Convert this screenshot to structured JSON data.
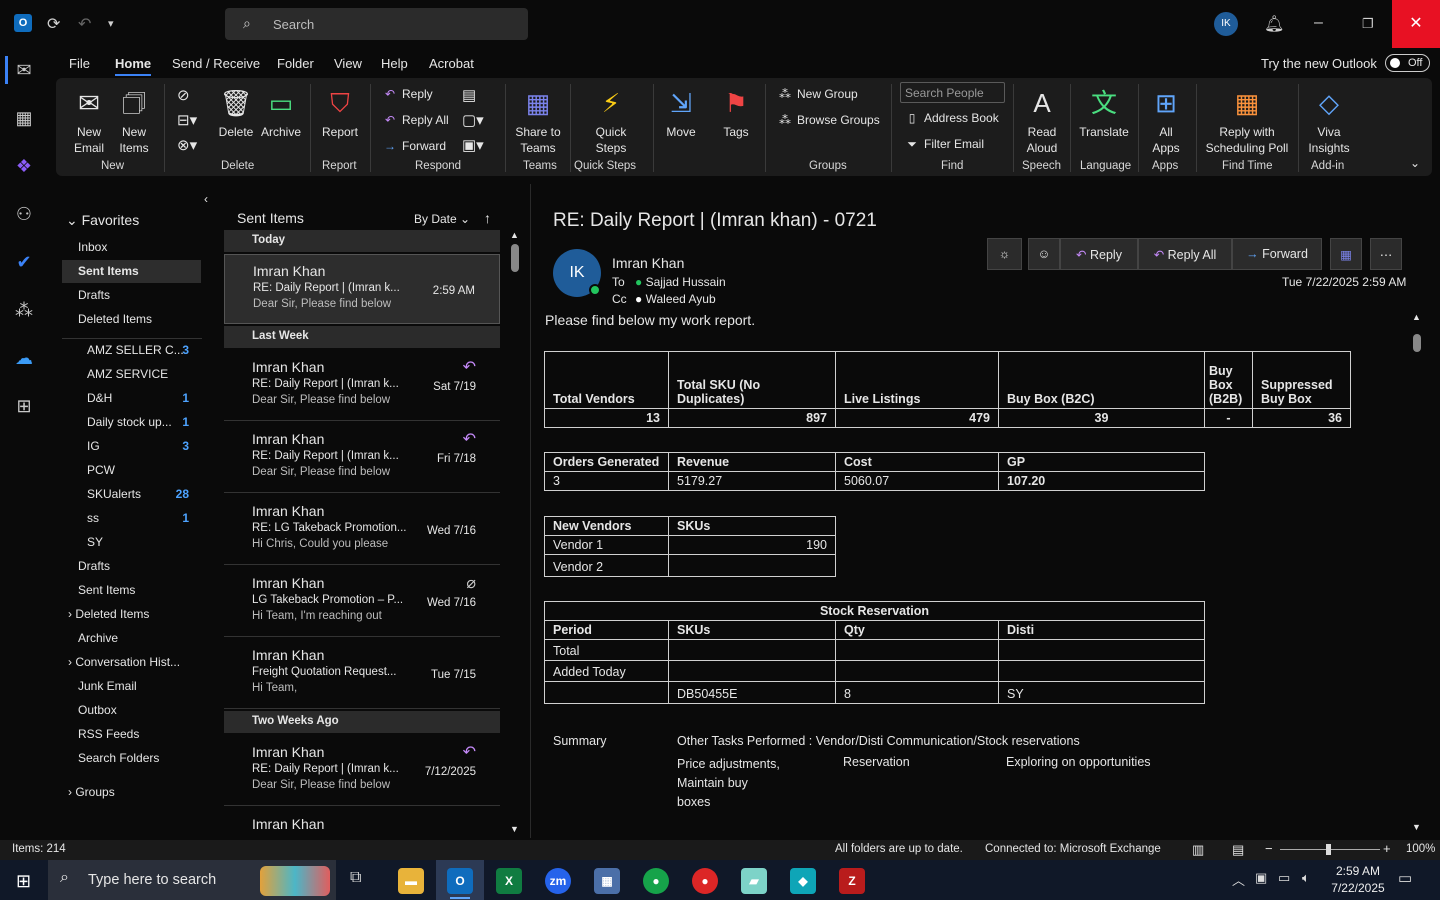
{
  "titlebar": {
    "search_placeholder": "Search",
    "avatar": "IK"
  },
  "menu": {
    "items": [
      "File",
      "Home",
      "Send / Receive",
      "Folder",
      "View",
      "Help",
      "Acrobat"
    ],
    "try_new": "Try the new Outlook",
    "toggle": "Off"
  },
  "ribbon": {
    "new_email": "New\nEmail",
    "new_items": "New\nItems",
    "delete": "Delete",
    "archive": "Archive",
    "report": "Report",
    "reply": "Reply",
    "reply_all": "Reply All",
    "forward": "Forward",
    "share_teams": "Share to\nTeams",
    "quick_steps": "Quick\nSteps",
    "move": "Move",
    "tags": "Tags",
    "new_group": "New Group",
    "browse_groups": "Browse Groups",
    "search_people": "Search People",
    "address_book": "Address Book",
    "filter_email": "Filter Email",
    "read_aloud": "Read\nAloud",
    "translate": "Translate",
    "all_apps": "All\nApps",
    "reply_poll": "Reply with\nScheduling Poll",
    "viva": "Viva\nInsights",
    "groups": [
      "New",
      "Delete",
      "Report",
      "Respond",
      "Teams",
      "Quick Steps",
      "Groups",
      "Find",
      "Speech",
      "Language",
      "Apps",
      "Find Time",
      "Add-in"
    ]
  },
  "folders": {
    "favorites": "Favorites",
    "fav_items": [
      "Inbox",
      "Sent Items",
      "Drafts",
      "Deleted Items"
    ],
    "sub_items": [
      {
        "name": "AMZ SELLER C...",
        "count": "3"
      },
      {
        "name": "AMZ SERVICE",
        "count": ""
      },
      {
        "name": "D&H",
        "count": "1"
      },
      {
        "name": "Daily stock up...",
        "count": "1"
      },
      {
        "name": "IG",
        "count": "3"
      },
      {
        "name": "PCW",
        "count": ""
      },
      {
        "name": "SKUalerts",
        "count": "28"
      },
      {
        "name": "ss",
        "count": "1"
      },
      {
        "name": "SY",
        "count": ""
      }
    ],
    "more_items": [
      "Drafts",
      "Sent Items",
      "Deleted Items",
      "Archive",
      "Conversation Hist...",
      "Junk Email",
      "Outbox",
      "RSS Feeds",
      "Search Folders"
    ],
    "groups": "Groups"
  },
  "list": {
    "title": "Sent Items",
    "sort": "By Date",
    "sections": [
      "Today",
      "Last Week",
      "Two Weeks Ago"
    ],
    "messages": [
      {
        "sender": "Imran Khan",
        "subject": "RE: Daily Report | (Imran k...",
        "preview": "Dear Sir,  Please find below",
        "date": "2:59 AM"
      },
      {
        "sender": "Imran Khan",
        "subject": "RE: Daily Report | (Imran k...",
        "preview": "Dear Sir,  Please find below",
        "date": "Sat 7/19"
      },
      {
        "sender": "Imran Khan",
        "subject": "RE: Daily Report | (Imran k...",
        "preview": "Dear Sir,  Please find below",
        "date": "Fri 7/18"
      },
      {
        "sender": "Imran Khan",
        "subject": "RE: LG Takeback Promotion...",
        "preview": "Hi Chris,  Could you please",
        "date": "Wed 7/16"
      },
      {
        "sender": "Imran Khan",
        "subject": "LG Takeback Promotion – P...",
        "preview": "Hi Team,  I'm reaching out",
        "date": "Wed 7/16"
      },
      {
        "sender": "Imran Khan",
        "subject": "Freight Quotation Request...",
        "preview": "Hi Team,",
        "date": "Tue 7/15"
      },
      {
        "sender": "Imran Khan",
        "subject": "RE: Daily Report | (Imran k...",
        "preview": "Dear Sir,  Please find below",
        "date": "7/12/2025"
      },
      {
        "sender": "Imran Khan",
        "subject": "",
        "preview": "",
        "date": ""
      }
    ]
  },
  "email": {
    "subject": "RE:  Daily Report | (Imran khan) - 0721",
    "avatar": "IK",
    "from": "Imran Khan",
    "to_label": "To",
    "to": "Sajjad Hussain",
    "cc_label": "Cc",
    "cc": "Waleed Ayub",
    "date": "Tue 7/22/2025 2:59 AM",
    "actions": {
      "reply": "Reply",
      "reply_all": "Reply All",
      "forward": "Forward"
    },
    "intro": "Please find below my work report.",
    "t1": {
      "headers": [
        "Total Vendors",
        "Total SKU (No Duplicates)",
        "Live Listings",
        "Buy Box (B2C)",
        "Buy\nBox\n(B2B)",
        "Suppressed\nBuy Box"
      ],
      "values": [
        "13",
        "897",
        "479",
        "39",
        "-",
        "36"
      ]
    },
    "t2": {
      "headers": [
        "Orders Generated",
        "Revenue",
        "Cost",
        "GP"
      ],
      "values": [
        "3",
        "5179.27",
        "5060.07",
        "107.20"
      ]
    },
    "t3": {
      "headers": [
        "New Vendors",
        "SKUs"
      ],
      "rows": [
        [
          "Vendor 1",
          "190"
        ],
        [
          "Vendor 2",
          ""
        ]
      ]
    },
    "t4": {
      "title": "Stock Reservation",
      "headers": [
        "Period",
        "SKUs",
        "Qty",
        "Disti"
      ],
      "rows": [
        [
          "Total",
          "",
          "",
          ""
        ],
        [
          "Added Today",
          "",
          "",
          ""
        ],
        [
          "",
          "DB50455E",
          "8",
          "SY"
        ]
      ]
    },
    "summary": {
      "label": "Summary",
      "other": "Other Tasks Performed :  Vendor/Disti Communication/Stock reservations",
      "c1": "Price adjustments,\nMaintain buy\nboxes",
      "c2": "Reservation",
      "c3": "Exploring on opportunities"
    }
  },
  "status": {
    "items": "Items: 214",
    "sync": "All folders are up to date.",
    "conn": "Connected to: Microsoft Exchange",
    "zoom": "100%"
  },
  "taskbar": {
    "search": "Type here to search",
    "time": "2:59 AM",
    "date": "7/22/2025"
  }
}
